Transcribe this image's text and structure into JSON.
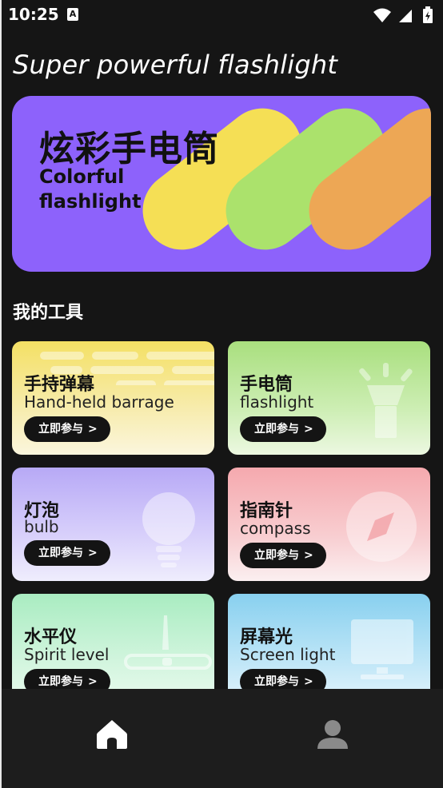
{
  "status_bar": {
    "time": "10:25",
    "notification_icon": "A"
  },
  "app": {
    "title": "Super powerful flashlight"
  },
  "banner": {
    "title_cn": "炫彩手电筒",
    "title_en": "Colorful flashlight"
  },
  "section": {
    "title": "我的工具"
  },
  "tools": [
    {
      "cn": "手持弹幕",
      "en": "Hand-held barrage",
      "button": "立即参与",
      "icon": "barrage-lines-icon"
    },
    {
      "cn": "手电筒",
      "en": "flashlight",
      "button": "立即参与",
      "icon": "flashlight-icon"
    },
    {
      "cn": "灯泡",
      "en": "bulb",
      "button": "立即参与",
      "icon": "bulb-icon"
    },
    {
      "cn": "指南针",
      "en": "compass",
      "button": "立即参与",
      "icon": "compass-icon"
    },
    {
      "cn": "水平仪",
      "en": "Spirit level",
      "button": "立即参与",
      "icon": "spirit-level-icon"
    },
    {
      "cn": "屏幕光",
      "en": "Screen light",
      "button": "立即参与",
      "icon": "monitor-icon"
    }
  ],
  "bottom_nav": {
    "items": [
      {
        "icon": "home-icon",
        "active": true
      },
      {
        "icon": "profile-icon",
        "active": false
      }
    ]
  }
}
